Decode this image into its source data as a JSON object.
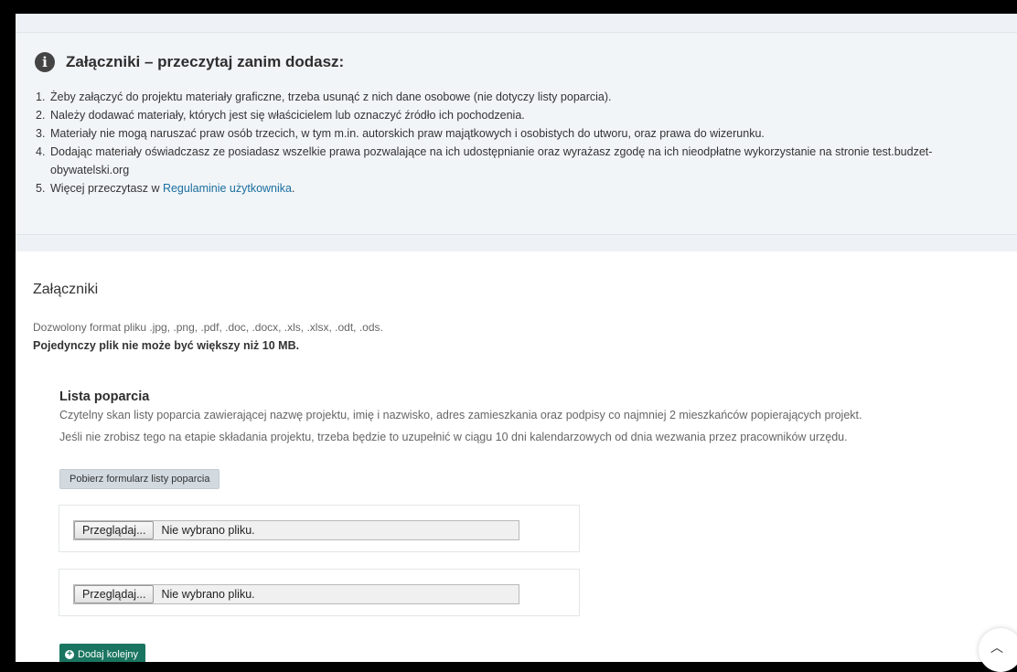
{
  "info": {
    "title": "Załączniki – przeczytaj zanim dodasz:",
    "rules": [
      {
        "n": "1.",
        "text": "Żeby załączyć do projektu materiały graficzne, trzeba usunąć z nich dane osobowe (nie dotyczy listy poparcia)."
      },
      {
        "n": "2.",
        "text": "Należy dodawać materiały, których jest się właścicielem lub oznaczyć źródło ich pochodzenia."
      },
      {
        "n": "3.",
        "text": "Materiały nie mogą naruszać praw osób trzecich, w tym m.in. autorskich praw majątkowych i osobistych do utworu, oraz prawa do wizerunku."
      },
      {
        "n": "4.",
        "text": "Dodając materiały oświadczasz ze posiadasz wszelkie prawa pozwalające na ich udostępnianie oraz wyrażasz zgodę na ich nieodpłatne wykorzystanie na stronie test.budzet-obywatelski.org"
      },
      {
        "n": "5.",
        "text": "Więcej przeczytasz w ",
        "link": "Regulaminie użytkownika",
        "after": "."
      }
    ]
  },
  "attachments": {
    "title": "Załączniki",
    "formats": "Dozwolony format pliku .jpg, .png, .pdf, .doc, .docx, .xls, .xlsx, .odt, .ods.",
    "max_size": "Pojedynczy plik nie może być większy niż 10 MB."
  },
  "support_list": {
    "title": "Lista poparcia",
    "desc1": "Czytelny skan listy poparcia zawierającej nazwę projektu, imię i nazwisko, adres zamieszkania oraz podpisy co najmniej 2 mieszkańców popierających projekt.",
    "desc2": "Jeśli nie zrobisz tego na etapie składania projektu, trzeba będzie to uzupełnić w ciągu 10 dni kalendarzowych od dnia wezwania przez pracowników urzędu.",
    "download_label": "Pobierz formularz listy poparcia",
    "uploads": [
      {
        "browse_label": "Przeglądaj...",
        "status": "Nie wybrano pliku."
      },
      {
        "browse_label": "Przeglądaj...",
        "status": "Nie wybrano pliku."
      }
    ],
    "add_label": "Dodaj kolejny"
  },
  "icons": {
    "info": "info-circle-icon",
    "plus": "plus-circle-icon",
    "scroll": "chevron-up-icon"
  },
  "colors": {
    "accent_green": "#1a7560",
    "link_blue": "#1a6e9e"
  }
}
